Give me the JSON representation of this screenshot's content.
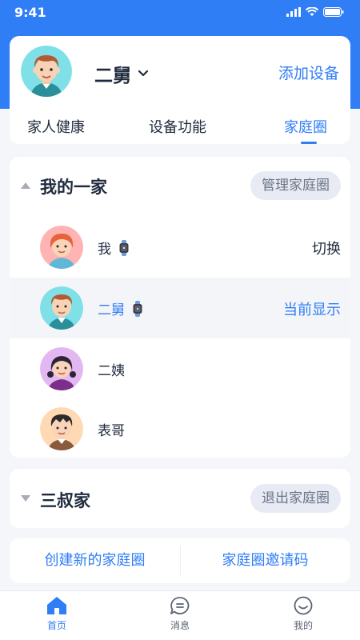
{
  "status": {
    "time": "9:41"
  },
  "header": {
    "profile_name": "二舅",
    "add_device": "添加设备",
    "tabs": [
      "家人健康",
      "设备功能",
      "家庭圈"
    ]
  },
  "group1": {
    "title": "我的一家",
    "manage_label": "管理家庭圈",
    "members": [
      {
        "name": "我",
        "action": "切换"
      },
      {
        "name": "二舅",
        "action": "当前显示"
      },
      {
        "name": "二姨",
        "action": ""
      },
      {
        "name": "表哥",
        "action": ""
      }
    ]
  },
  "group2": {
    "title": "三叔家",
    "exit_label": "退出家庭圈"
  },
  "actions": {
    "create": "创建新的家庭圈",
    "invite": "家庭圈邀请码"
  },
  "tabbar": {
    "items": [
      "首页",
      "消息",
      "我的"
    ]
  },
  "colors": {
    "accent": "#2f7ef5"
  }
}
